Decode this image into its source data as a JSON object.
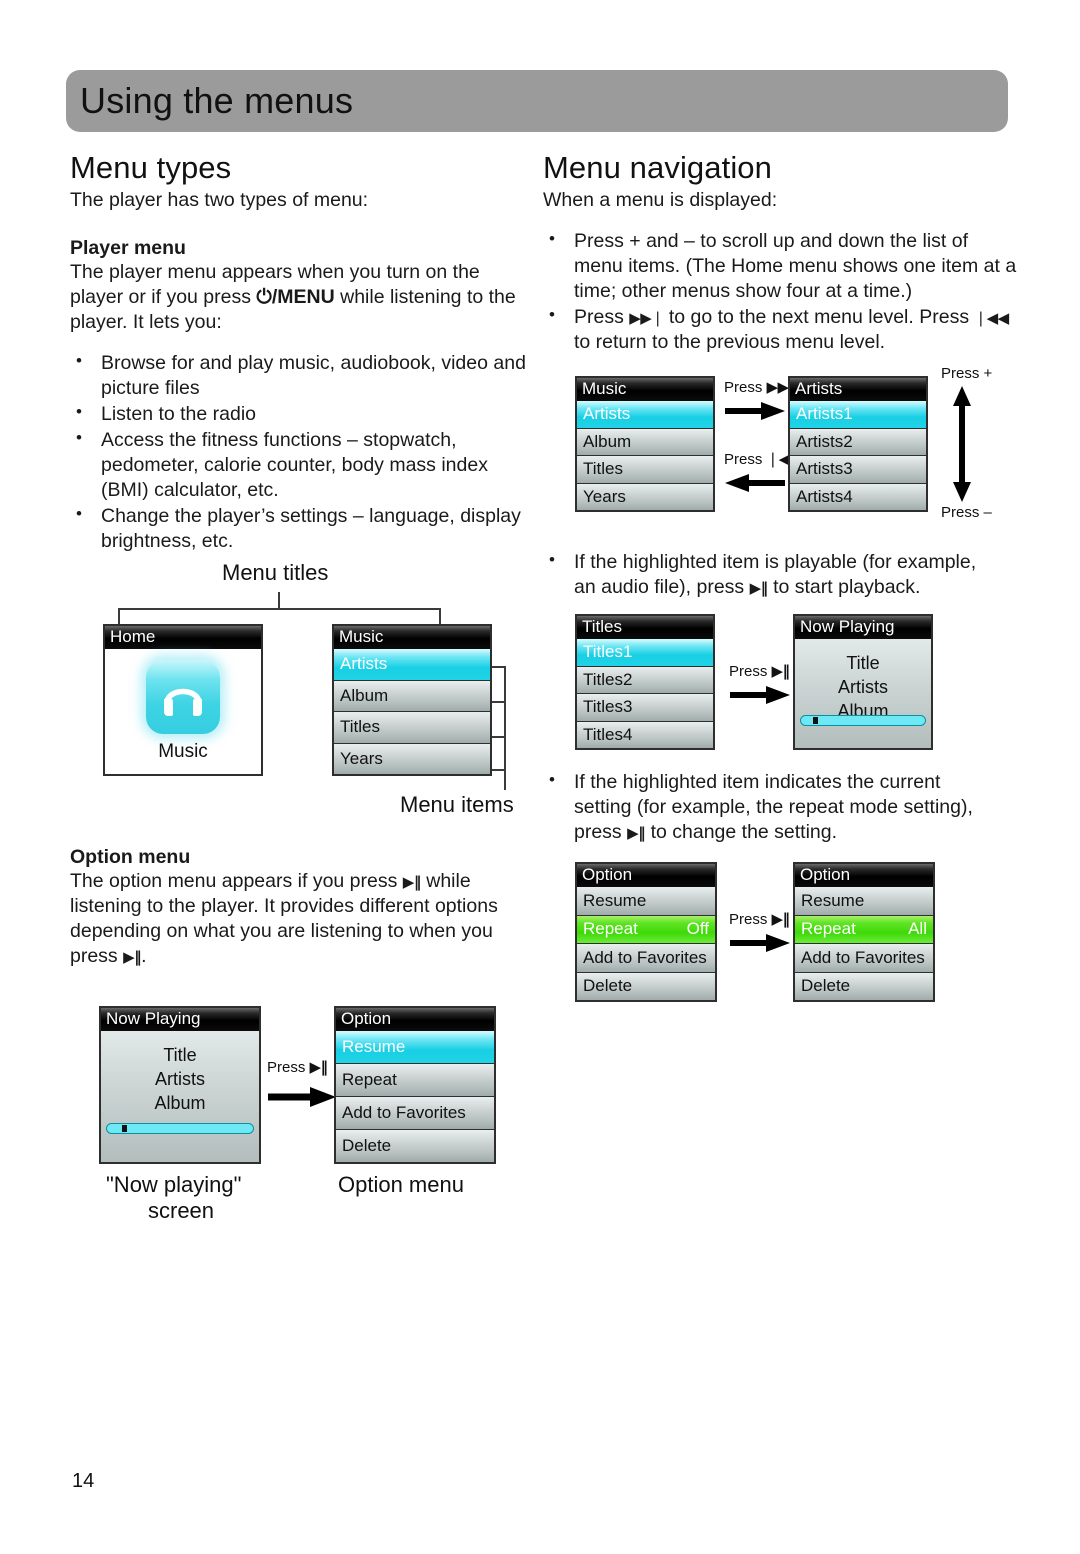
{
  "header": {
    "title": "Using the menus"
  },
  "page": {
    "number": "14"
  },
  "left": {
    "section_title": "Menu types",
    "lead": "The player has two types of menu:",
    "player_menu": {
      "heading": "Player menu",
      "para_1": "The player menu appears when you turn on the",
      "para_2_pre": "player or if you press ",
      "para_2_key": "/MENU",
      "para_2_post": " while listening to the",
      "para_3": "player. It lets you:",
      "bullets": [
        "Browse for and play music, audiobook, video and picture files",
        "Listen to the radio",
        "Access the fitness functions – stopwatch, pedometer, calorie counter, body mass index (BMI) calculator, etc.",
        "Change the player’s settings – language, display brightness, etc."
      ]
    },
    "diagram_titles": {
      "caption_top": "Menu titles",
      "caption_bottom": "Menu items",
      "home_screen": {
        "title": "Home",
        "icon": "headphones-icon",
        "label": "Music"
      },
      "music_screen": {
        "title": "Music",
        "items": [
          "Artists",
          "Album",
          "Titles",
          "Years"
        ],
        "highlighted_index": 0
      }
    },
    "option_menu": {
      "heading": "Option menu",
      "para_1_pre": "The option menu appears if you press ",
      "para_1_key": "▶‖",
      "para_1_post": " while",
      "para_2": "listening to the player. It provides different options",
      "para_3": "depending on what you are listening to when you",
      "para_4_pre": "press ",
      "para_4_key": "▶‖",
      "para_4_post": "."
    },
    "diagram_option": {
      "now_playing": {
        "title": "Now Playing",
        "lines": [
          "Title",
          "Artists",
          "Album"
        ],
        "progress_percent": 10
      },
      "press_label": "Press",
      "press_glyph": "▶‖",
      "option_screen": {
        "title": "Option",
        "items": [
          "Resume",
          "Repeat",
          "Add to Favorites",
          "Delete"
        ],
        "highlighted_index": 0
      },
      "caption_left_line1": "\"Now playing\"",
      "caption_left_line2": "screen",
      "caption_right": "Option menu"
    }
  },
  "right": {
    "section_title": "Menu navigation",
    "lead": "When a menu is displayed:",
    "bullets": [
      {
        "pre": "Press + and – to scroll up and down the list of menu items. (The Home menu shows one item at a time; other menus show four at a time.)"
      },
      {
        "pre": "Press ",
        "glyph1": "▶▶❘",
        "mid": " to go to the next menu level. Press ",
        "glyph2": "❘◀◀",
        "post": " to return to the previous menu level."
      }
    ],
    "nav_diagram_1": {
      "music_screen": {
        "title": "Music",
        "items": [
          "Artists",
          "Album",
          "Titles",
          "Years"
        ],
        "highlighted_index": 0
      },
      "artists_screen": {
        "title": "Artists",
        "items": [
          "Artists1",
          "Artists2",
          "Artists3",
          "Artists4"
        ],
        "highlighted_index": 0
      },
      "press_next_label": "Press",
      "press_next_glyph": "▶▶❘",
      "press_prev_label": "Press",
      "press_prev_glyph": "❘◀◀",
      "press_plus": "Press +",
      "press_minus": "Press –"
    },
    "playable_note_1": "If the highlighted item is playable (for example,",
    "playable_note_2_pre": "an audio file), press ",
    "playable_note_2_key": "▶‖",
    "playable_note_2_post": " to start playback.",
    "nav_diagram_2": {
      "titles_screen": {
        "title": "Titles",
        "items": [
          "Titles1",
          "Titles2",
          "Titles3",
          "Titles4"
        ],
        "highlighted_index": 0
      },
      "now_playing_screen": {
        "title": "Now Playing",
        "lines": [
          "Title",
          "Artists",
          "Album"
        ],
        "progress_percent": 10
      },
      "press_label": "Press",
      "press_glyph": "▶‖"
    },
    "setting_note_1": "If the highlighted item indicates the current",
    "setting_note_2": "setting (for example, the repeat mode setting),",
    "setting_note_3_pre": "press ",
    "setting_note_3_key": "▶‖",
    "setting_note_3_post": " to change the setting.",
    "nav_diagram_3": {
      "option_before": {
        "title": "Option",
        "items": [
          "Resume",
          "Repeat",
          "Add to Favorites",
          "Delete"
        ],
        "repeat_value": "Off",
        "highlighted_index": 1
      },
      "option_after": {
        "title": "Option",
        "items": [
          "Resume",
          "Repeat",
          "Add to Favorites",
          "Delete"
        ],
        "repeat_value": "All",
        "highlighted_index": 1
      },
      "press_label": "Press",
      "press_glyph": "▶‖"
    }
  },
  "colors": {
    "header_bg": "#9b9b9b",
    "highlight_cyan": "#18cfe4",
    "highlight_green": "#4fe81e",
    "screen_bg": "#c3cccb"
  }
}
